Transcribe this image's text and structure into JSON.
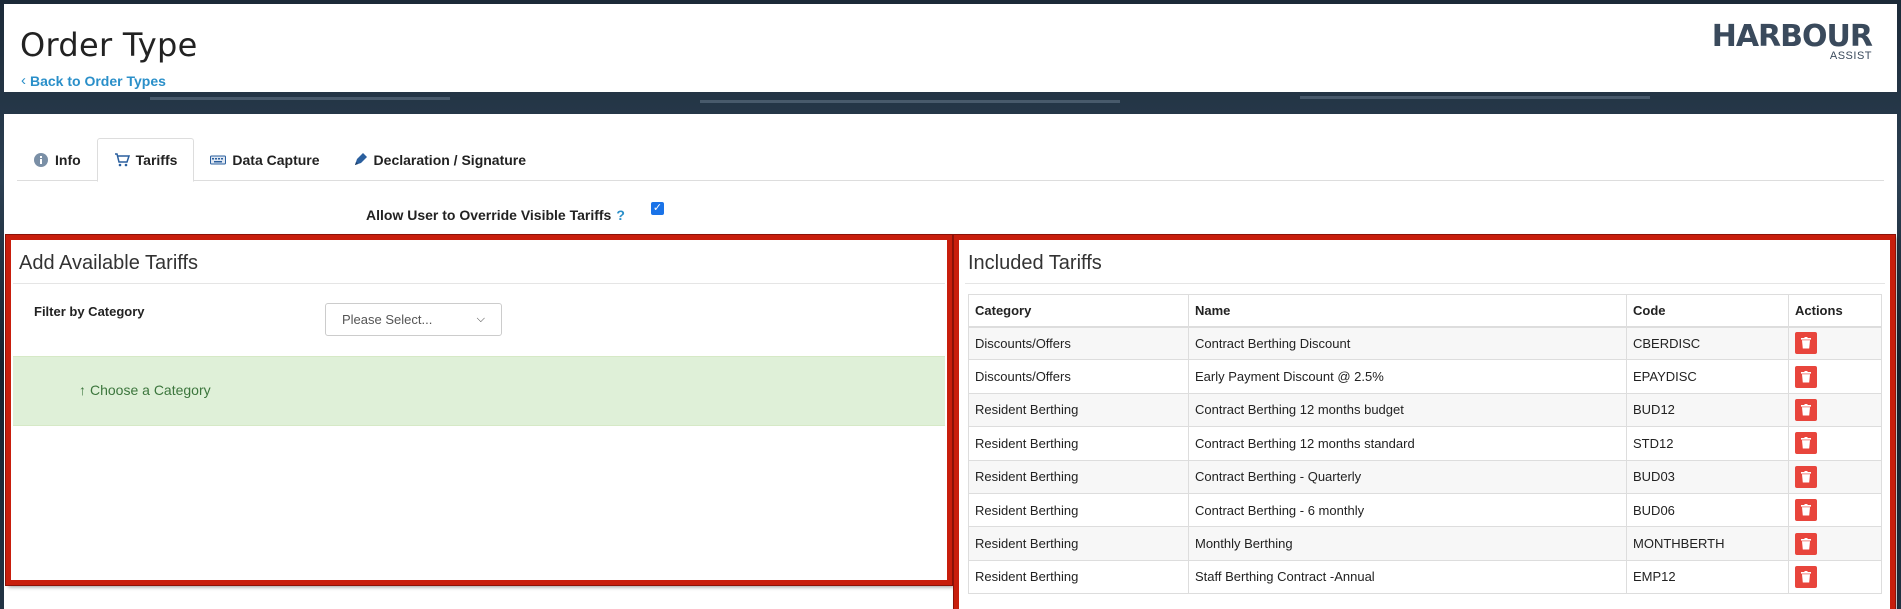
{
  "header": {
    "title": "Order Type",
    "back_link": "Back to Order Types",
    "logo_main": "HARBOUR",
    "logo_sub": "ASSIST"
  },
  "tabs": [
    {
      "label": "Info",
      "icon": "info-icon"
    },
    {
      "label": "Tariffs",
      "icon": "cart-icon",
      "active": true
    },
    {
      "label": "Data Capture",
      "icon": "keyboard-icon"
    },
    {
      "label": "Declaration / Signature",
      "icon": "pen-icon"
    }
  ],
  "override": {
    "label": "Allow User to Override Visible Tariffs",
    "help": "?",
    "checked": true
  },
  "available": {
    "title": "Add Available Tariffs",
    "filter_label": "Filter by Category",
    "filter_value": "Please Select...",
    "hint": "Choose a Category"
  },
  "included": {
    "title": "Included Tariffs",
    "columns": [
      "Category",
      "Name",
      "Code",
      "Actions"
    ],
    "rows": [
      {
        "category": "Discounts/Offers",
        "name": "Contract Berthing Discount",
        "code": "CBERDISC"
      },
      {
        "category": "Discounts/Offers",
        "name": "Early Payment Discount @ 2.5%",
        "code": "EPAYDISC"
      },
      {
        "category": "Resident Berthing",
        "name": "Contract Berthing 12 months budget",
        "code": "BUD12"
      },
      {
        "category": "Resident Berthing",
        "name": "Contract Berthing 12 months standard",
        "code": "STD12"
      },
      {
        "category": "Resident Berthing",
        "name": "Contract Berthing - Quarterly",
        "code": "BUD03"
      },
      {
        "category": "Resident Berthing",
        "name": "Contract Berthing - 6 monthly",
        "code": "BUD06"
      },
      {
        "category": "Resident Berthing",
        "name": "Monthly Berthing",
        "code": "MONTHBERTH"
      },
      {
        "category": "Resident Berthing",
        "name": "Staff Berthing Contract -Annual",
        "code": "EMP12"
      }
    ]
  },
  "colors": {
    "accent": "#2a8fc9",
    "highlight": "#c81e0c",
    "delete": "#e8453c",
    "hint_bg": "#dff0d8"
  }
}
